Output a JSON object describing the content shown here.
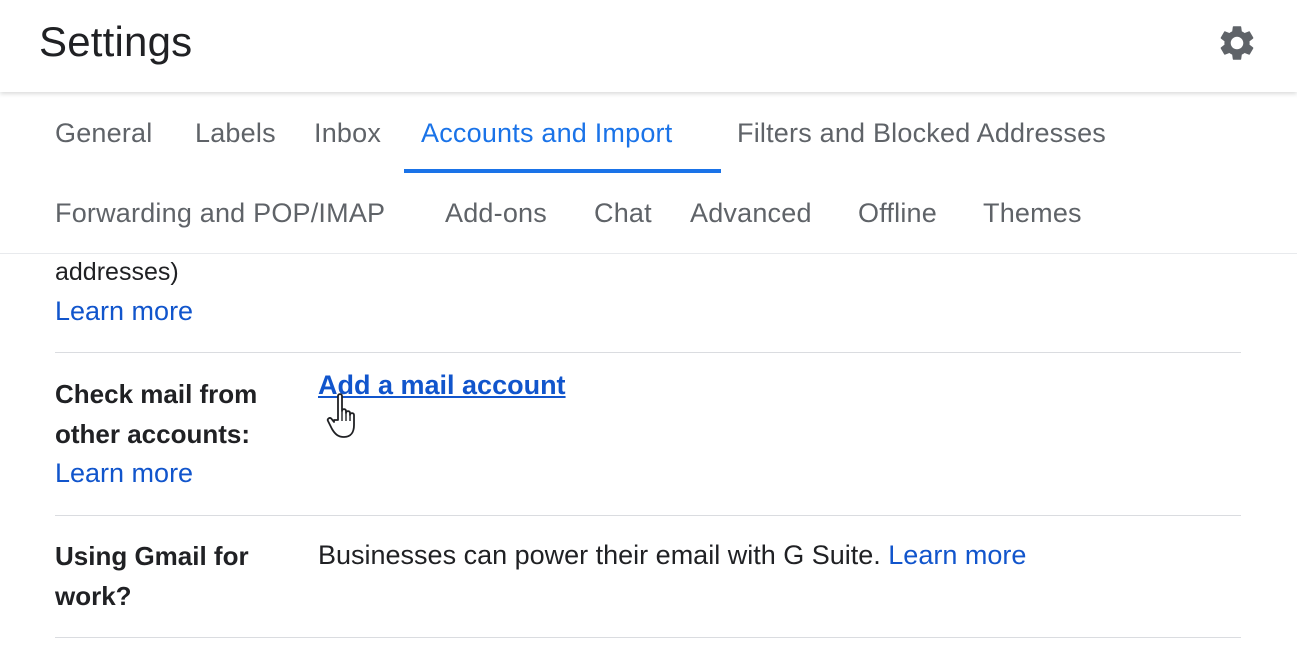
{
  "header": {
    "title": "Settings",
    "settings_icon": "gear-icon"
  },
  "tabs": [
    {
      "label": "General",
      "active": false
    },
    {
      "label": "Labels",
      "active": false
    },
    {
      "label": "Inbox",
      "active": false
    },
    {
      "label": "Accounts and Import",
      "active": true
    },
    {
      "label": "Filters and Blocked Addresses",
      "active": false
    },
    {
      "label": "Forwarding and POP/IMAP",
      "active": false
    },
    {
      "label": "Add-ons",
      "active": false
    },
    {
      "label": "Chat",
      "active": false
    },
    {
      "label": "Advanced",
      "active": false
    },
    {
      "label": "Offline",
      "active": false
    },
    {
      "label": "Themes",
      "active": false
    }
  ],
  "sections": {
    "previous": {
      "trailing_text": "addresses)",
      "learn_more": "Learn more"
    },
    "check_mail": {
      "label_line1": "Check mail from",
      "label_line2": "other accounts:",
      "learn_more": "Learn more",
      "action": "Add a mail account"
    },
    "gmail_work": {
      "label_line1": "Using Gmail for",
      "label_line2": "work?",
      "text": "Businesses can power their email with G Suite.",
      "learn_more": "Learn more"
    }
  },
  "colors": {
    "accent": "#1a73e8",
    "link": "#1155cc",
    "tab_text": "#5f6368"
  },
  "cursor_icon": "pointer-hand-icon"
}
